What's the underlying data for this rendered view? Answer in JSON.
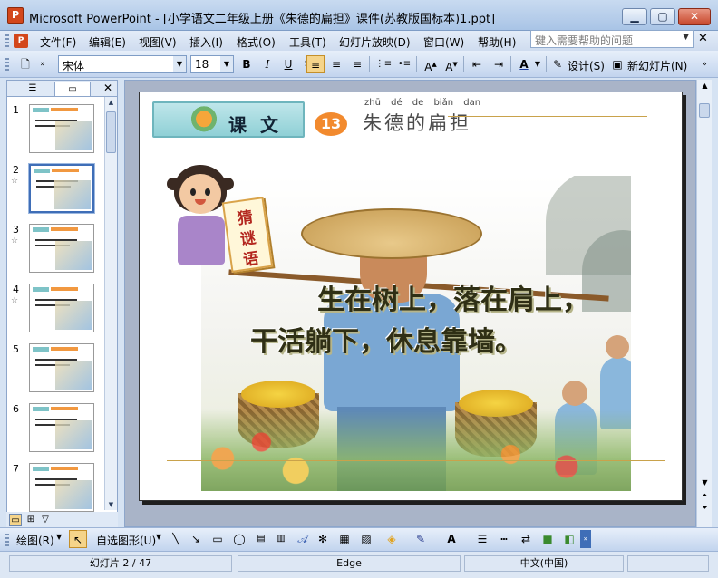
{
  "window": {
    "app_icon": "powerpoint-icon",
    "title": "Microsoft PowerPoint - [小学语文二年级上册《朱德的扁担》课件(苏教版国标本)1.ppt]",
    "minimize": "▁",
    "maximize": "▢",
    "close": "✕"
  },
  "menu": {
    "items": [
      "文件(F)",
      "编辑(E)",
      "视图(V)",
      "插入(I)",
      "格式(O)",
      "工具(T)",
      "幻灯片放映(D)",
      "窗口(W)",
      "帮助(H)"
    ],
    "help_placeholder": "键入需要帮助的问题",
    "doc_close": "✕"
  },
  "toolbar": {
    "font_name": "宋体",
    "font_size": "18",
    "bold": "B",
    "italic": "I",
    "underline": "U",
    "font_color": "A",
    "design": "设计(S)",
    "new_slide": "新幻灯片(N)",
    "icons": [
      "new-doc-icon",
      "align-left-icon",
      "align-center-icon",
      "align-right-icon",
      "numbered-list-icon",
      "bullet-list-icon",
      "increase-font-icon",
      "decrease-font-icon",
      "decrease-indent-icon",
      "increase-indent-icon"
    ]
  },
  "slides_pane": {
    "close": "✕",
    "slides": [
      {
        "num": "1",
        "star": ""
      },
      {
        "num": "2",
        "star": "☆"
      },
      {
        "num": "3",
        "star": "☆"
      },
      {
        "num": "4",
        "star": "☆"
      },
      {
        "num": "5",
        "star": ""
      },
      {
        "num": "6",
        "star": ""
      },
      {
        "num": "7",
        "star": ""
      }
    ],
    "selected_index": 1
  },
  "slide": {
    "lesson_label": "课 文",
    "lesson_number": "13",
    "pinyin": "zhū dé de biǎn dan",
    "lesson_title": "朱德的扁担",
    "riddle_tag": [
      "猜",
      "谜",
      "语"
    ],
    "riddle_line1": "生在树上，落在肩上，",
    "riddle_line2": "干活躺下，休息靠墙。"
  },
  "drawing_toolbar": {
    "draw": "绘图(R)",
    "autoshapes": "自选图形(U)"
  },
  "status": {
    "slide_position": "幻灯片 2 / 47",
    "design": "Edge",
    "language": "中文(中国)"
  },
  "colors": {
    "title_bar": "#b9cfeb",
    "accent_orange": "#f28a2e",
    "riddle_red": "#b3261e",
    "selection_blue": "#3f6eb7"
  }
}
